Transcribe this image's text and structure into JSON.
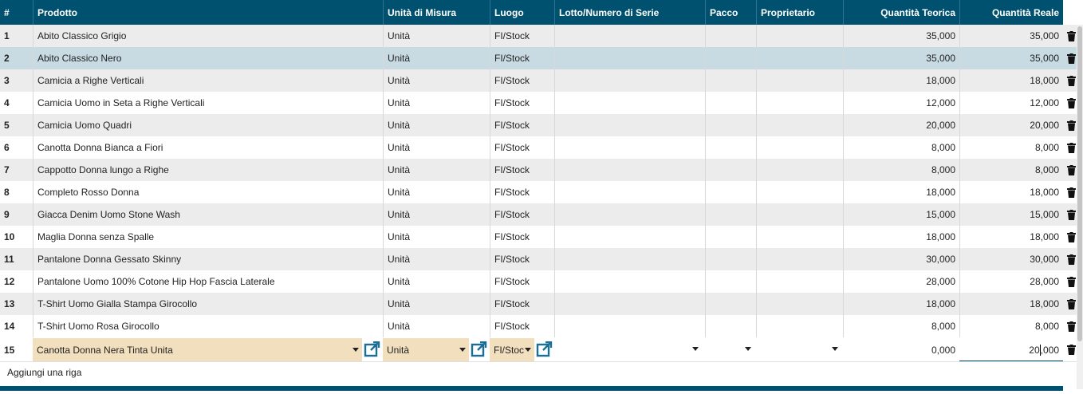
{
  "columns": {
    "idx": "#",
    "product": "Prodotto",
    "uom": "Unità di Misura",
    "location": "Luogo",
    "lot": "Lotto/Numero di Serie",
    "package": "Pacco",
    "owner": "Proprietario",
    "theoretical": "Quantità Teorica",
    "real": "Quantità Reale"
  },
  "rows": [
    {
      "n": "1",
      "product": "Abito Classico Grigio",
      "uom": "Unità",
      "location": "FI/Stock",
      "theoretical": "35,000",
      "real": "35,000"
    },
    {
      "n": "2",
      "product": "Abito Classico Nero",
      "uom": "Unità",
      "location": "FI/Stock",
      "theoretical": "35,000",
      "real": "35,000"
    },
    {
      "n": "3",
      "product": "Camicia a Righe Verticali",
      "uom": "Unità",
      "location": "FI/Stock",
      "theoretical": "18,000",
      "real": "18,000"
    },
    {
      "n": "4",
      "product": "Camicia Uomo in Seta a Righe Verticali",
      "uom": "Unità",
      "location": "FI/Stock",
      "theoretical": "12,000",
      "real": "12,000"
    },
    {
      "n": "5",
      "product": "Camicia Uomo Quadri",
      "uom": "Unità",
      "location": "FI/Stock",
      "theoretical": "20,000",
      "real": "20,000"
    },
    {
      "n": "6",
      "product": "Canotta Donna Bianca a Fiori",
      "uom": "Unità",
      "location": "FI/Stock",
      "theoretical": "8,000",
      "real": "8,000"
    },
    {
      "n": "7",
      "product": "Cappotto Donna lungo a Righe",
      "uom": "Unità",
      "location": "FI/Stock",
      "theoretical": "8,000",
      "real": "8,000"
    },
    {
      "n": "8",
      "product": "Completo Rosso Donna",
      "uom": "Unità",
      "location": "FI/Stock",
      "theoretical": "18,000",
      "real": "18,000"
    },
    {
      "n": "9",
      "product": "Giacca Denim Uomo Stone Wash",
      "uom": "Unità",
      "location": "FI/Stock",
      "theoretical": "15,000",
      "real": "15,000"
    },
    {
      "n": "10",
      "product": "Maglia Donna senza Spalle",
      "uom": "Unità",
      "location": "FI/Stock",
      "theoretical": "18,000",
      "real": "18,000"
    },
    {
      "n": "11",
      "product": "Pantalone Donna Gessato Skinny",
      "uom": "Unità",
      "location": "FI/Stock",
      "theoretical": "30,000",
      "real": "30,000"
    },
    {
      "n": "12",
      "product": "Pantalone Uomo 100% Cotone Hip Hop Fascia Laterale",
      "uom": "Unità",
      "location": "FI/Stock",
      "theoretical": "28,000",
      "real": "28,000"
    },
    {
      "n": "13",
      "product": "T-Shirt Uomo Gialla Stampa Girocollo",
      "uom": "Unità",
      "location": "FI/Stock",
      "theoretical": "18,000",
      "real": "18,000"
    },
    {
      "n": "14",
      "product": "T-Shirt Uomo Rosa Girocollo",
      "uom": "Unità",
      "location": "FI/Stock",
      "theoretical": "8,000",
      "real": "8,000"
    }
  ],
  "edit_row": {
    "n": "15",
    "product": "Canotta Donna Nera Tinta Unita",
    "uom": "Unità",
    "location": "FI/Stoc",
    "theoretical": "0,000",
    "real_before": "20",
    "real_after": ",000"
  },
  "add_line": "Aggiungi una riga",
  "colors": {
    "header": "#00516f",
    "edit": "#f2dfbd",
    "selected": "#c8dbe3"
  },
  "icons": {
    "delete": "trash-icon",
    "open": "external-link-icon",
    "dropdown": "caret-down-icon"
  }
}
